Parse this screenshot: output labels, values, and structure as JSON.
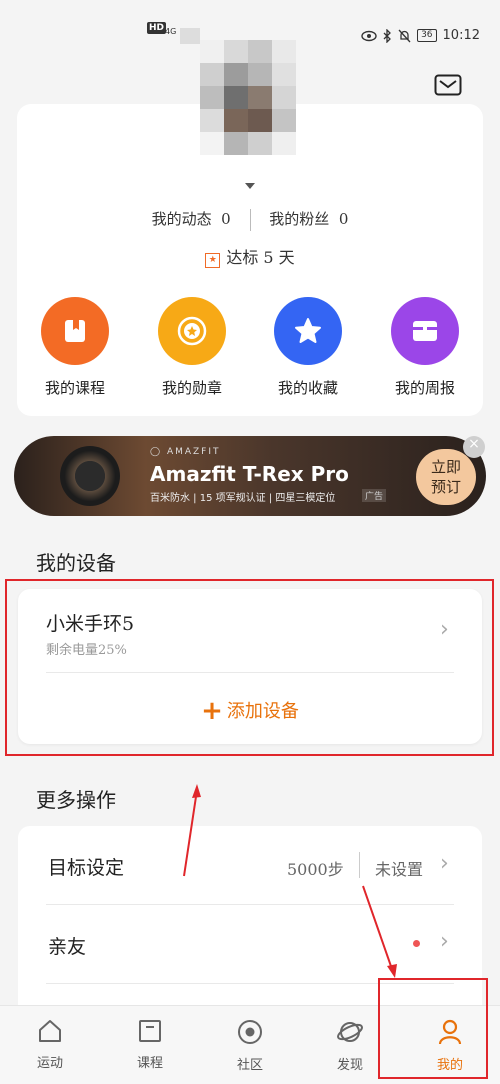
{
  "status_bar": {
    "left_badge": "HD",
    "network": "4G",
    "battery": "36",
    "time": "10:12"
  },
  "profile": {
    "dynamics_label": "我的动态",
    "dynamics_count": "0",
    "fans_label": "我的粉丝",
    "fans_count": "0",
    "goal_text": "达标 5 天"
  },
  "features": [
    {
      "label": "我的课程",
      "color": "#f36b25",
      "icon": "bookmark-book-icon"
    },
    {
      "label": "我的勋章",
      "color": "#f7a916",
      "icon": "medal-icon"
    },
    {
      "label": "我的收藏",
      "color": "#3465f3",
      "icon": "star-icon"
    },
    {
      "label": "我的周报",
      "color": "#9b46e8",
      "icon": "report-toolbox-icon"
    }
  ],
  "banner": {
    "brand": "AMAZFIT",
    "title": "Amazfit T-Rex Pro",
    "subtitle": "百米防水 | 15 项军规认证 | 四星三模定位",
    "ad_label": "广告",
    "button_line1": "立即",
    "button_line2": "预订"
  },
  "devices": {
    "title": "我的设备",
    "device_name": "小米手环5",
    "battery_text": "剩余电量25%",
    "add_label": "添加设备"
  },
  "more": {
    "title": "更多操作",
    "goal_label": "目标设定",
    "goal_steps": "5000步",
    "goal_state": "未设置",
    "friends_label": "亲友"
  },
  "nav": [
    {
      "label": "运动",
      "icon": "home-icon"
    },
    {
      "label": "课程",
      "icon": "course-icon"
    },
    {
      "label": "社区",
      "icon": "community-icon"
    },
    {
      "label": "发现",
      "icon": "discover-icon"
    },
    {
      "label": "我的",
      "icon": "profile-icon"
    }
  ],
  "colors": {
    "accent": "#e8720c",
    "highlight_box": "#e0262b"
  }
}
